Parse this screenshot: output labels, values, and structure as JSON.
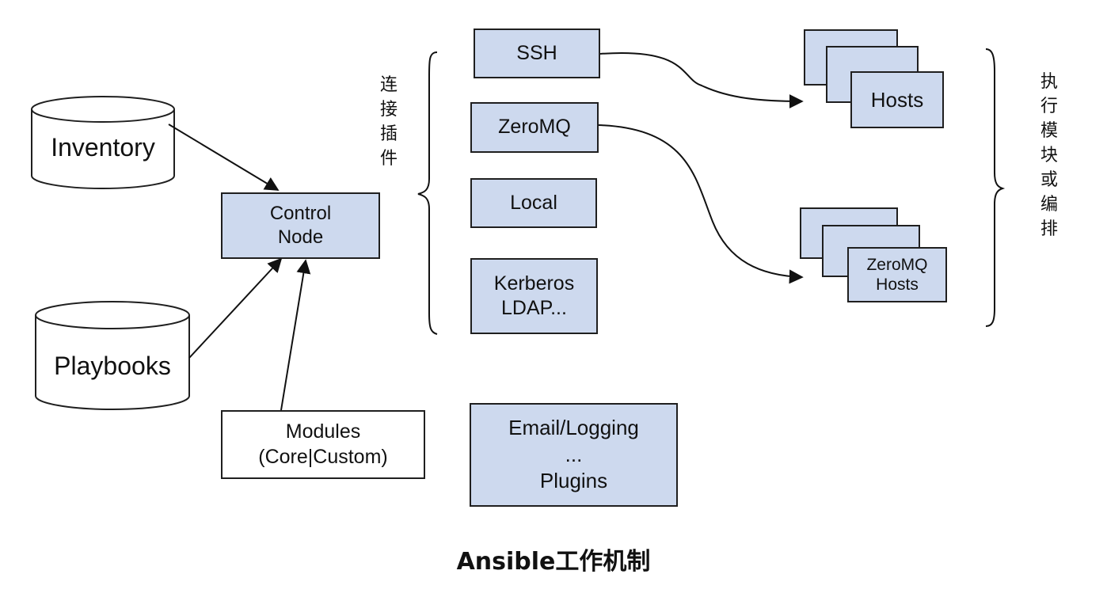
{
  "databases": {
    "inventory": "Inventory",
    "playbooks": "Playbooks"
  },
  "control_node": [
    "Control",
    "Node"
  ],
  "modules": [
    "Modules",
    "(Core|Custom)"
  ],
  "connection_group_label": [
    "连",
    "接",
    "插",
    "件"
  ],
  "connections": {
    "ssh": "SSH",
    "zeromq": "ZeroMQ",
    "local": "Local",
    "kerberos": [
      "Kerberos",
      "LDAP..."
    ]
  },
  "plugins": [
    "Email/Logging",
    "...",
    "Plugins"
  ],
  "hosts": {
    "ssh_hosts": "Hosts",
    "zeromq_hosts": [
      "ZeroMQ",
      "Hosts"
    ]
  },
  "execution_group_label": [
    "执",
    "行",
    "模",
    "块",
    "或",
    "编",
    "排"
  ],
  "caption": "Ansible工作机制",
  "colors": {
    "box_fill": "#cdd9ee",
    "stroke": "#1f1f1f"
  }
}
